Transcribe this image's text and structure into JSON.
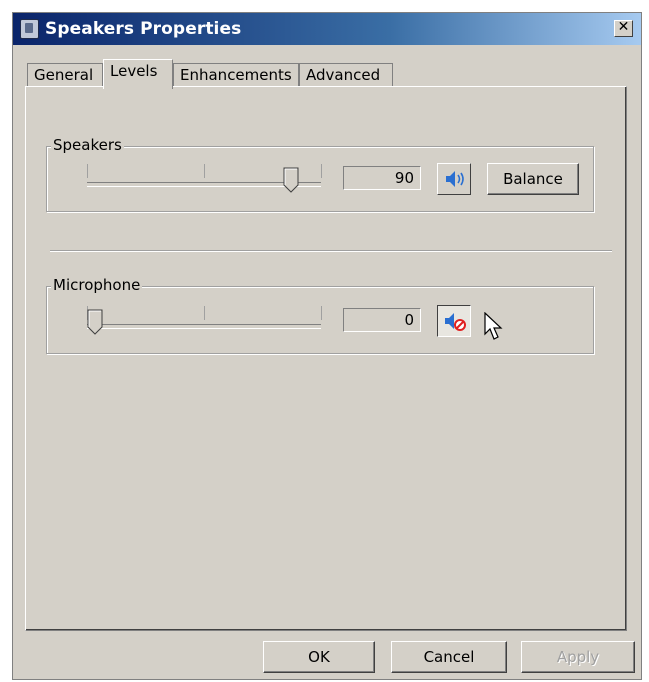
{
  "window": {
    "title": "Speakers Properties",
    "close_label": "✕"
  },
  "tabs": [
    {
      "label": "General"
    },
    {
      "label": "Levels"
    },
    {
      "label": "Enhancements"
    },
    {
      "label": "Advanced"
    }
  ],
  "active_tab": "Levels",
  "speakers": {
    "label": "Speakers",
    "value": "90",
    "level": 90,
    "muted": false,
    "balance_label": "Balance"
  },
  "microphone": {
    "label": "Microphone",
    "value": "0",
    "level": 0,
    "muted": true
  },
  "footer": {
    "ok_label": "OK",
    "cancel_label": "Cancel",
    "apply_label": "Apply"
  },
  "colors": {
    "title_start": "#0a246a",
    "title_end": "#a6caf0",
    "face": "#d4d0c8",
    "speaker_blue": "#2a6fd1",
    "mute_red": "#e02020"
  }
}
